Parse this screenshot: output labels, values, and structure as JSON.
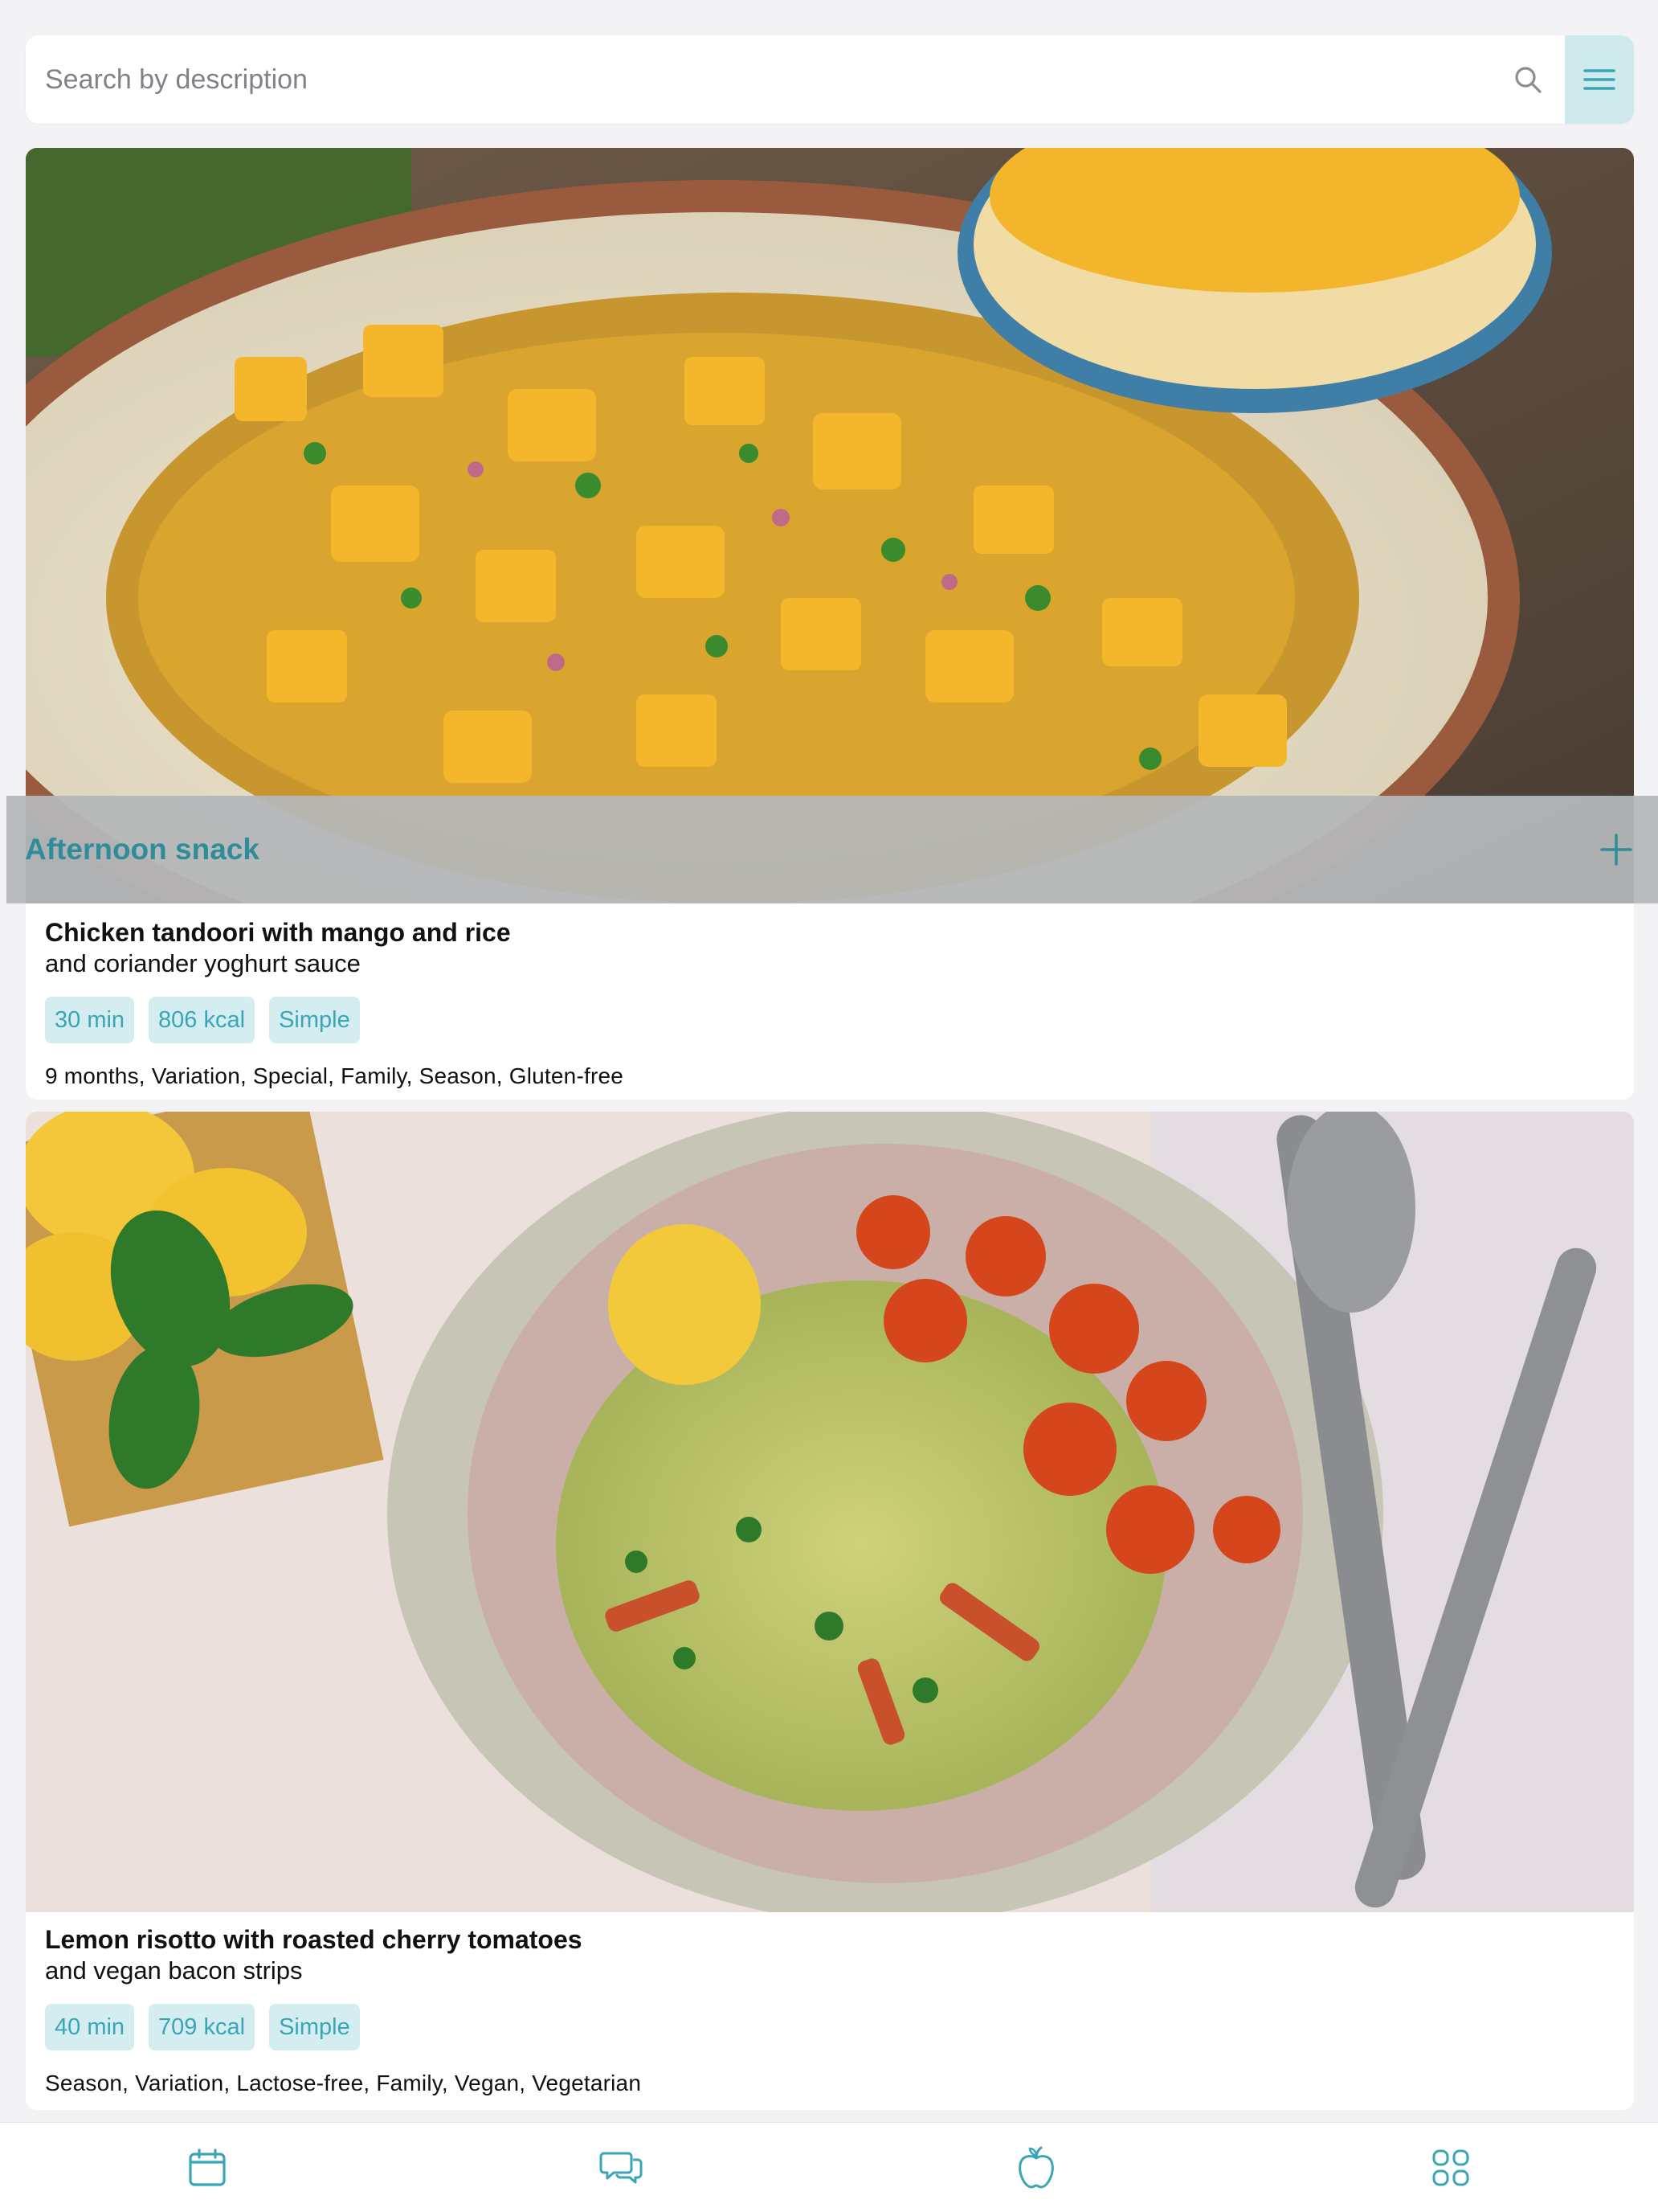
{
  "search": {
    "placeholder": "Search by description"
  },
  "section": {
    "title": "Afternoon snack"
  },
  "recipes": [
    {
      "title": "Chicken tandoori with mango and rice",
      "subtitle": "and coriander yoghurt sauce",
      "time": "30 min",
      "kcal": "806 kcal",
      "difficulty": "Simple",
      "tags": "9 months, Variation, Special, Family, Season, Gluten-free"
    },
    {
      "title": "Lemon risotto with roasted cherry tomatoes",
      "subtitle": "and vegan bacon strips",
      "time": "40 min",
      "kcal": "709 kcal",
      "difficulty": "Simple",
      "tags": "Season, Variation, Lactose-free, Family, Vegan, Vegetarian"
    }
  ],
  "bottom_nav": [
    {
      "icon": "calendar-icon"
    },
    {
      "icon": "chat-bubbles-icon"
    },
    {
      "icon": "apple-icon"
    },
    {
      "icon": "grid-icon"
    }
  ],
  "colors": {
    "accent": "#3aa5b5",
    "accent_dark": "#2f8d99",
    "chip_bg": "#d4edf1",
    "background": "#f3f3f5"
  }
}
